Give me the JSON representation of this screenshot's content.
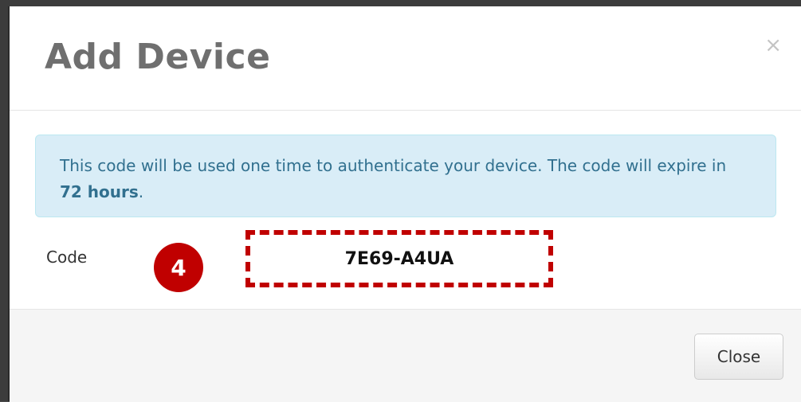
{
  "modal": {
    "title": "Add Device",
    "close_icon_glyph": "×"
  },
  "alert": {
    "text_before": "This code will be used one time to authenticate your device. The code will expire in ",
    "emphasis": "72 hours",
    "text_after": "."
  },
  "code": {
    "label": "Code",
    "value": "7E69-A4UA"
  },
  "annotation": {
    "step_number": "4",
    "color": "#c00000"
  },
  "footer": {
    "close_label": "Close"
  },
  "colors": {
    "alert_background": "#d9edf7",
    "alert_text": "#31708f",
    "title_text": "#6f6f6f"
  }
}
